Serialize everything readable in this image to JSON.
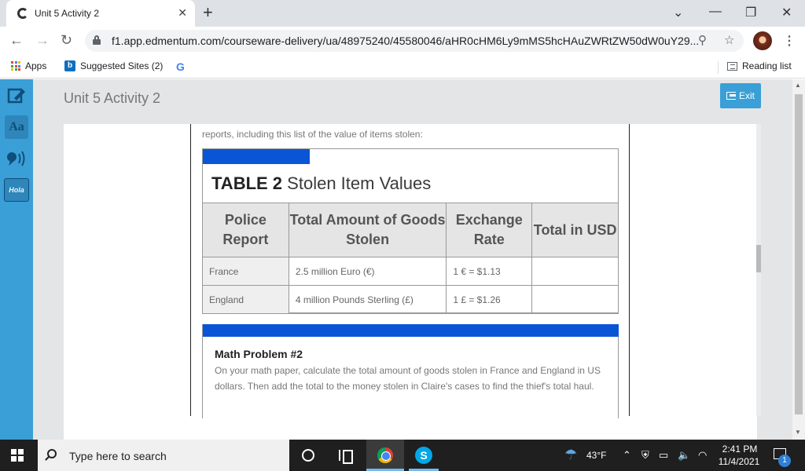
{
  "browser": {
    "tab_title": "Unit 5 Activity 2",
    "tab_close": "✕",
    "new_tab": "+",
    "window_controls": {
      "minimize": "—",
      "restore": "❐",
      "close": "✕",
      "tab_search": "⌄"
    },
    "nav": {
      "back": "←",
      "forward": "→",
      "reload": "↻"
    },
    "url": "f1.app.edmentum.com/courseware-delivery/ua/48975240/45580046/aHR0cHM6Ly9mMS5hcHAuZWRtZW50dW0uY29...",
    "zoom_icon": "⚲",
    "star_icon": "☆",
    "menu": "⋮"
  },
  "bookmarks": {
    "apps": "Apps",
    "suggested": "Suggested Sites (2)",
    "google": "G",
    "reading_list": "Reading list"
  },
  "page": {
    "title": "Unit 5 Activity 2",
    "exit_label": "Exit",
    "rail_icons": [
      "edit-icon",
      "dictionary-icon",
      "speaker-icon",
      "translate-icon"
    ],
    "rail_labels": {
      "dictionary": "Aa",
      "translate": "Hola"
    }
  },
  "content": {
    "intro": "reports, including this list of the value of items stolen:",
    "table": {
      "label": "TABLE 2",
      "title": "Stolen Item Values",
      "headers": [
        "Police Report",
        "Total Amount of Goods Stolen",
        "Exchange Rate",
        "Total in USD"
      ],
      "rows": [
        [
          "France",
          "2.5 million Euro (€)",
          "1 € = $1.13",
          ""
        ],
        [
          "England",
          "4 million Pounds Sterling (£)",
          "1 £ = $1.26",
          ""
        ]
      ]
    },
    "problem": {
      "title": "Math Problem #2",
      "text": "On your math paper, calculate the total amount of goods stolen in France and England in US dollars. Then add the total to the money stolen in Claire's cases to find the thief's total haul."
    }
  },
  "taskbar": {
    "search_placeholder": "Type here to search",
    "weather_temp": "43°F",
    "time": "2:41 PM",
    "date": "11/4/2021",
    "notification_count": "1"
  },
  "colors": {
    "accent_blue": "#0a55d6",
    "rail_blue": "#3a9fd6",
    "header_gray": "#e4e5e6"
  }
}
